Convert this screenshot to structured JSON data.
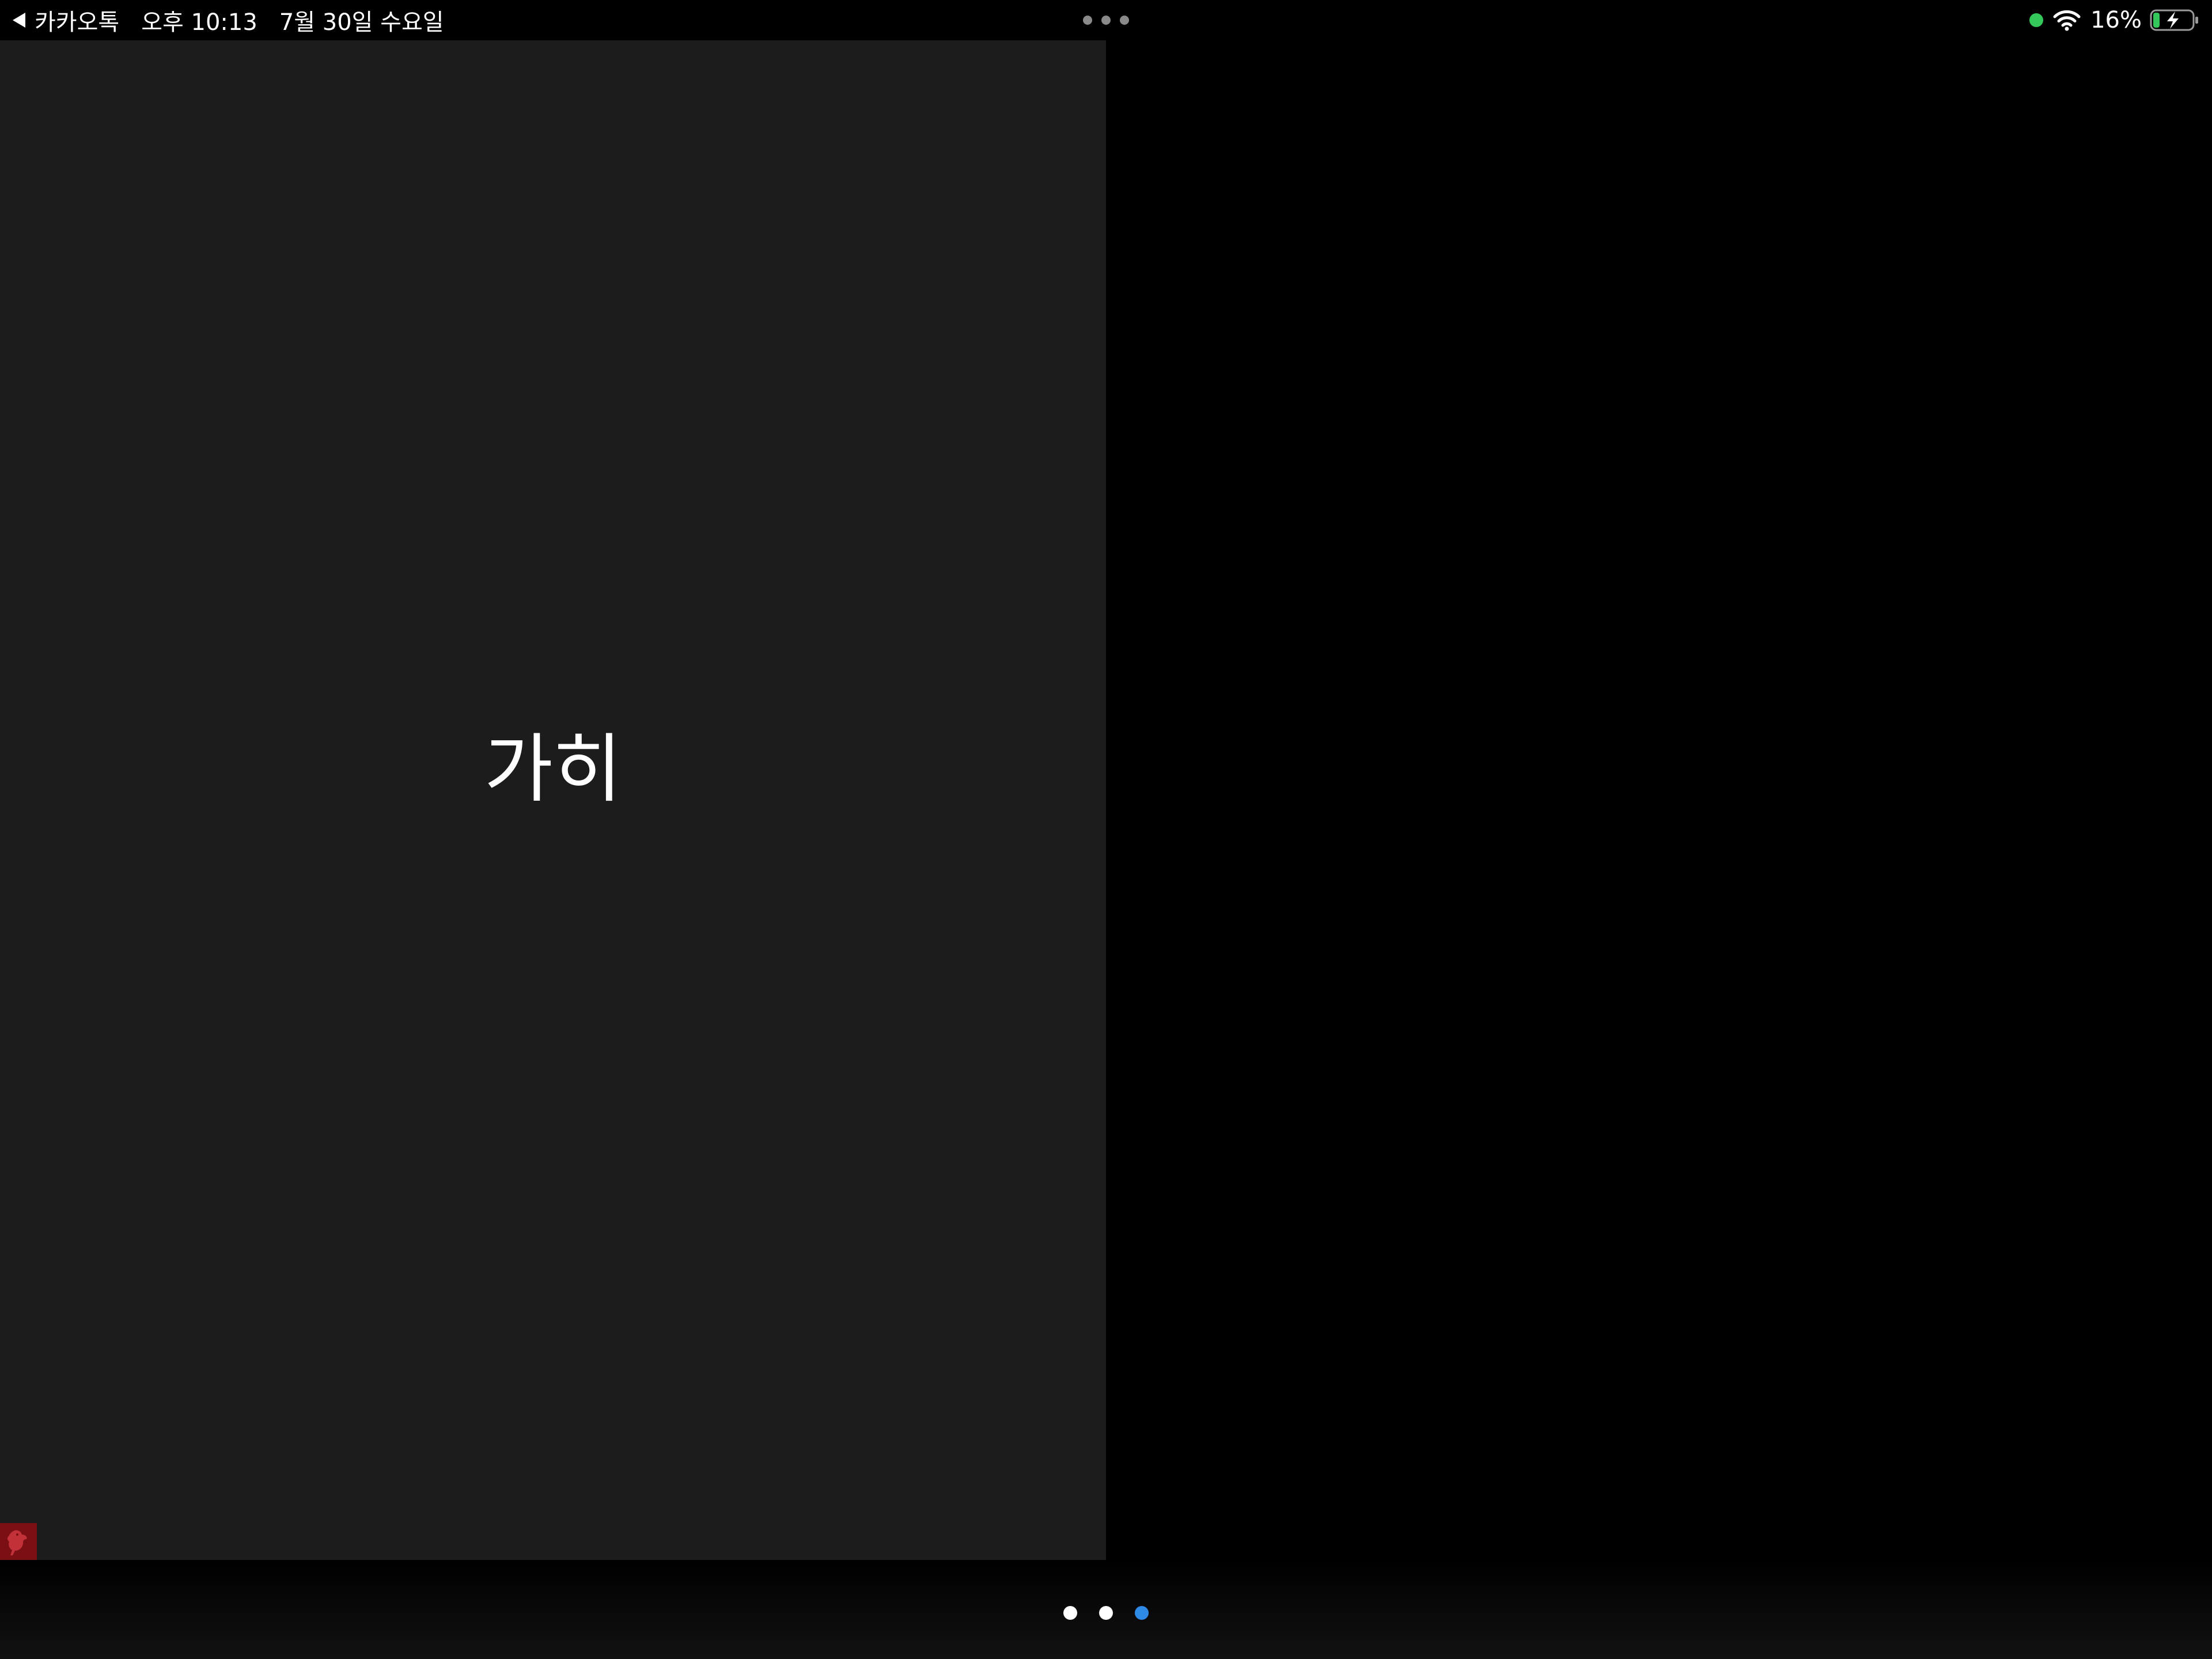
{
  "status_bar": {
    "back_app": "카카오톡",
    "time": "오후 10:13",
    "date": "7월 30일 수요일",
    "battery_percent": "16%",
    "battery_level": 0.16,
    "charging": true,
    "icons": {
      "back": "back-arrow-icon",
      "multitask": "multitask-dots-icon",
      "mic_indicator": "mic-indicator-dot",
      "wifi": "wifi-icon",
      "battery": "battery-charging-icon"
    },
    "colors": {
      "mic_indicator": "#34c759",
      "battery_fill": "#34c759"
    }
  },
  "content": {
    "text": "가히",
    "background": "#1c1c1c",
    "corner_badge_icon": "bird-icon"
  },
  "pager": {
    "pages": 3,
    "current_page": 3,
    "active_color": "#2f8ae6",
    "inactive_color": "#ffffff"
  }
}
